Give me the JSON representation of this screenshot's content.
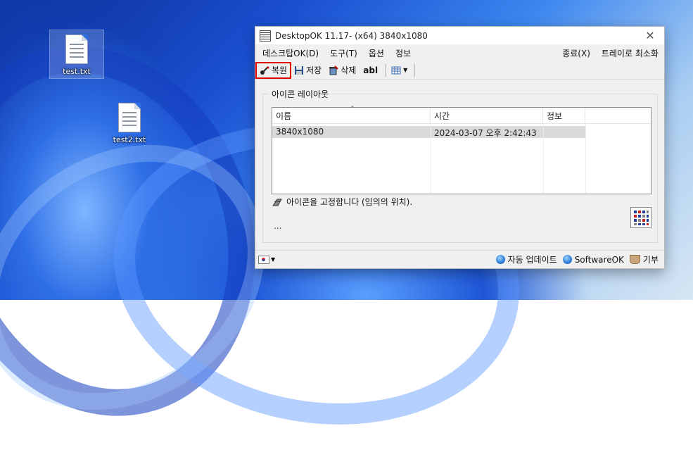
{
  "desktop": {
    "icons": [
      {
        "label": "test.txt",
        "icon": "text-file-icon"
      },
      {
        "label": "test2.txt",
        "icon": "text-file-icon"
      }
    ]
  },
  "window": {
    "title": "DesktopOK 11.17- (x64) 3840x1080",
    "close_symbol": "✕",
    "menu": {
      "desktop": "데스크탑OK(D)",
      "tools": "도구(T)",
      "options": "옵션",
      "info": "정보",
      "exit": "종료(X)",
      "tray_minimize": "트레이로 최소화"
    },
    "toolbar": {
      "restore": "복원",
      "save": "저장",
      "delete": "삭제",
      "rename": "abl"
    },
    "group_label": "아이콘 레이아웃",
    "list": {
      "columns": [
        "이름",
        "시간",
        "정보"
      ],
      "rows": [
        {
          "name": "3840x1080",
          "time": "2024-03-07 오후 2:42:43",
          "info": ""
        }
      ]
    },
    "hint": "아이콘을 고정합니다 (임의의 위치).",
    "ellipsis": "...",
    "status": {
      "update": "자동 업데이트",
      "softwareok": "SoftwareOK",
      "donate": "기부"
    }
  }
}
